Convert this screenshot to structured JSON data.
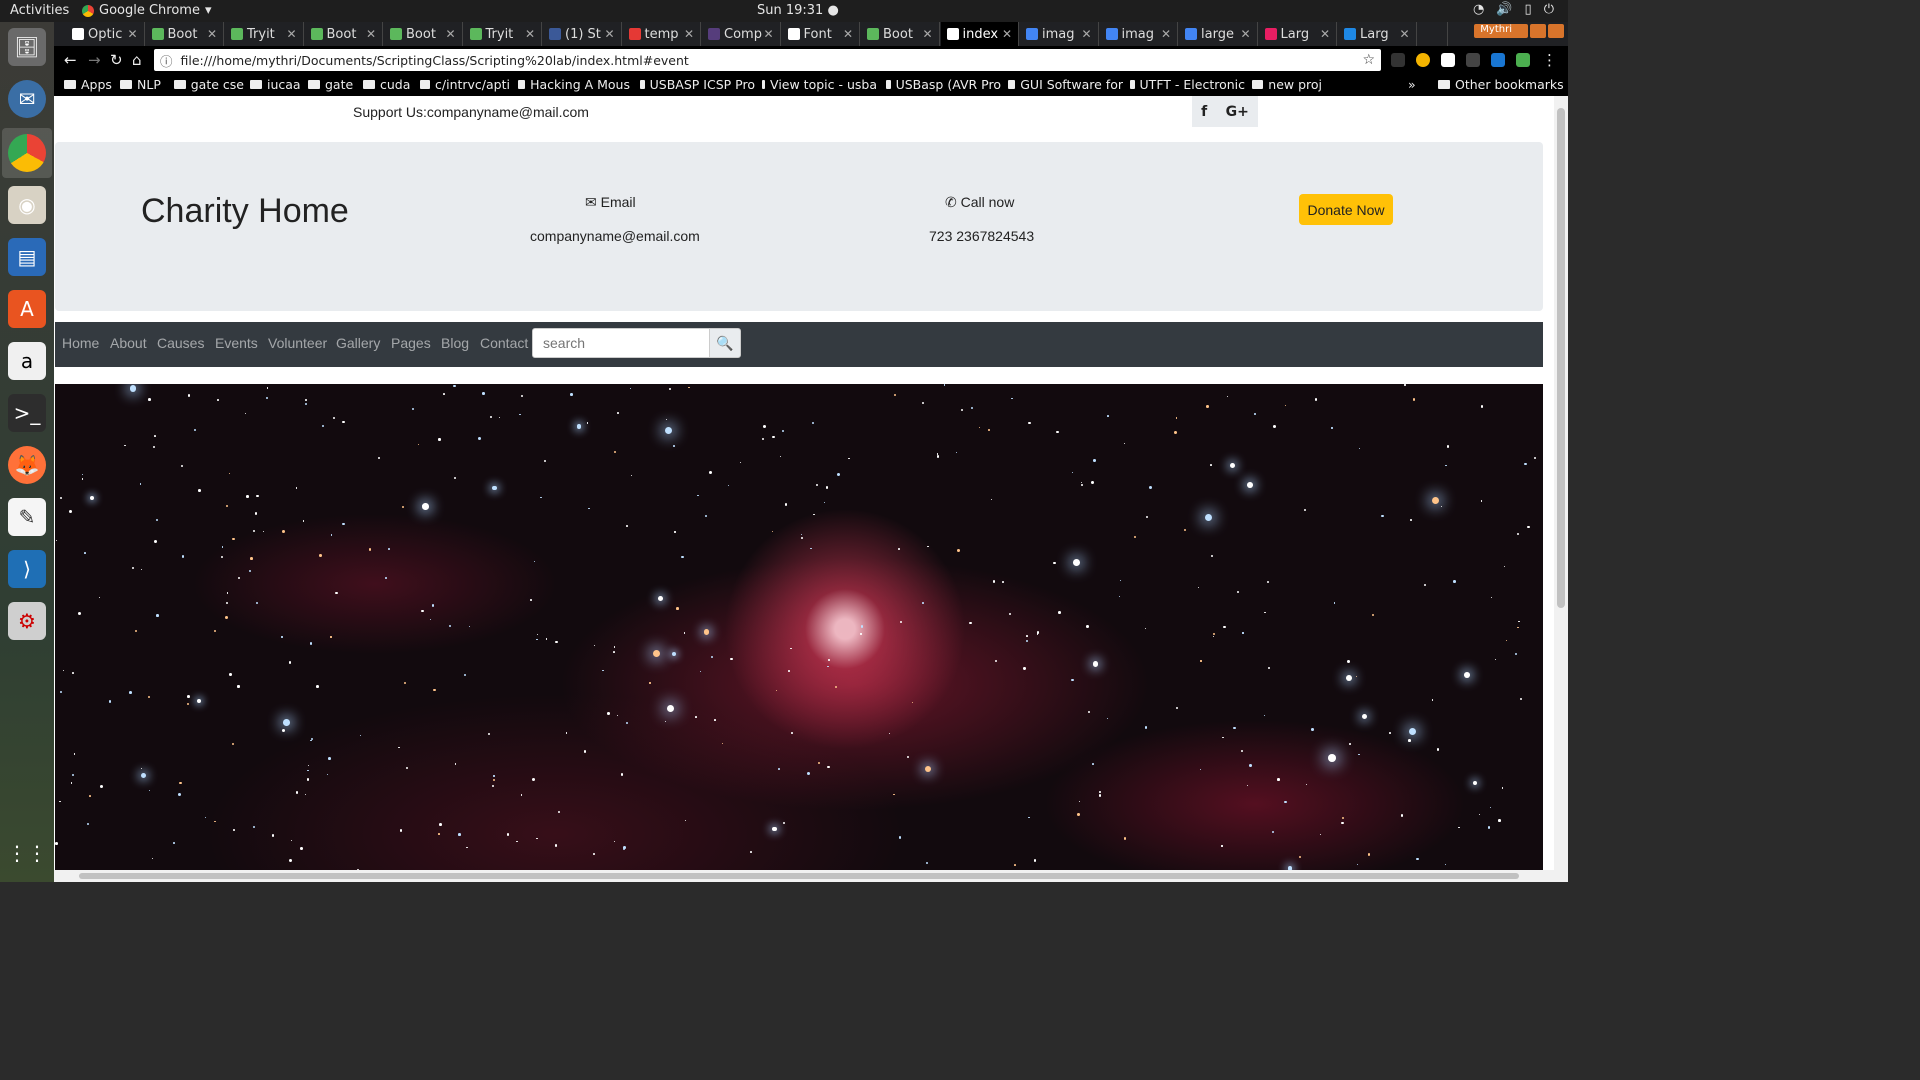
{
  "system": {
    "activities": "Activities",
    "app_name": "Google Chrome",
    "clock": "Sun 19:31",
    "user": "Mythri"
  },
  "tabs": [
    {
      "label": "Optic",
      "color": "#ffffff"
    },
    {
      "label": "Boot",
      "color": "#5cb85c"
    },
    {
      "label": "Tryit",
      "color": "#5cb85c"
    },
    {
      "label": "Boot",
      "color": "#5cb85c"
    },
    {
      "label": "Boot",
      "color": "#5cb85c"
    },
    {
      "label": "Tryit",
      "color": "#5cb85c"
    },
    {
      "label": "(1) St",
      "color": "#3b5998"
    },
    {
      "label": "temp",
      "color": "#e53935"
    },
    {
      "label": "Comp",
      "color": "#563d7c"
    },
    {
      "label": "Font",
      "color": "#ffffff"
    },
    {
      "label": "Boot",
      "color": "#5cb85c"
    },
    {
      "label": "index",
      "color": "#ffffff"
    },
    {
      "label": "imag",
      "color": "#4285f4"
    },
    {
      "label": "imag",
      "color": "#4285f4"
    },
    {
      "label": "large",
      "color": "#4285f4"
    },
    {
      "label": "Larg",
      "color": "#e91e63"
    },
    {
      "label": "Larg",
      "color": "#1e88e5"
    }
  ],
  "address": {
    "url": "file:///home/mythri/Documents/ScriptingClass/Scripting%20lab/index.html#event"
  },
  "bookmarks": [
    {
      "label": "Apps"
    },
    {
      "label": "NLP"
    },
    {
      "label": "gate cse"
    },
    {
      "label": "iucaa"
    },
    {
      "label": "gate"
    },
    {
      "label": "cuda"
    },
    {
      "label": "c/intrvc/apti"
    },
    {
      "label": "Hacking A Mous"
    },
    {
      "label": "USBASP ICSP Pro"
    },
    {
      "label": "View topic - usba"
    },
    {
      "label": "USBasp (AVR Pro"
    },
    {
      "label": "GUI Software for"
    },
    {
      "label": "UTFT - Electronic"
    },
    {
      "label": "new proj"
    }
  ],
  "other_bookmarks": "Other bookmarks",
  "page": {
    "support": "Support Us:companyname@mail.com",
    "social": {
      "facebook": "f",
      "gplus": "G+"
    },
    "brand": "Charity Home",
    "email_heading": "Email",
    "email_value": "companyname@email.com",
    "call_heading": "Call now",
    "call_value": "723 2367824543",
    "donate": "Donate Now",
    "nav": [
      "Home",
      "About",
      "Causes",
      "Events",
      "Volunteer",
      "Gallery",
      "Pages",
      "Blog",
      "Contact"
    ],
    "search_placeholder": "search"
  }
}
